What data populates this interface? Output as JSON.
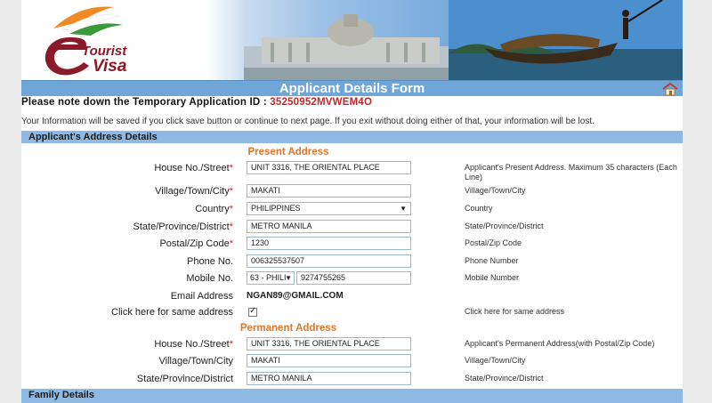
{
  "banner": {
    "logo_line1": "Tourist",
    "logo_line2": "Visa"
  },
  "header": {
    "title": "Applicant Details Form",
    "home_icon": "home-icon"
  },
  "notice": {
    "prefix": "Please note down the Temporary Application ID : ",
    "application_id": "35250952MVWEM4O",
    "info": "Your Information will be saved if you click save button or continue to next page. If you exit without doing either of that, your information will be lost."
  },
  "address_section": {
    "title": "Applicant's Address Details",
    "present_title": "Present Address",
    "permanent_title": "Permanent Address"
  },
  "present": {
    "house": {
      "label": "House No./Street",
      "required": "*",
      "value": "UNIT 3316, THE ORIENTAL PLACE",
      "hint": "Applicant's Present Address. Maximum 35 characters (Each Line)"
    },
    "village": {
      "label": "Village/Town/City",
      "required": "*",
      "value": "MAKATI",
      "hint": "Village/Town/City"
    },
    "country": {
      "label": "Country",
      "required": "*",
      "value": "PHILIPPINES",
      "hint": "Country"
    },
    "state": {
      "label": "State/Province/District",
      "required": "*",
      "value": "METRO MANILA",
      "hint": "State/Province/District"
    },
    "postal": {
      "label": "Postal/Zip Code",
      "required": "*",
      "value": "1230",
      "hint": "Postal/Zip Code"
    },
    "phone": {
      "label": "Phone No.",
      "value": "006325537507",
      "hint": "Phone Number"
    },
    "mobile": {
      "label": "Mobile No.",
      "code": "63 - PHILI",
      "value": "9274755265",
      "hint": "Mobile Number"
    },
    "email": {
      "label": "Email Address",
      "value": "NGAN89@GMAIL.COM"
    },
    "same": {
      "label": "Click here for same address",
      "hint": "Click here for same address"
    }
  },
  "permanent": {
    "house": {
      "label": "House No./Street",
      "required": "*",
      "value": "UNIT 3316, THE ORIENTAL PLACE",
      "hint": "Applicant's Permanent Address(with Postal/Zip Code)"
    },
    "village": {
      "label": "Village/Town/City",
      "value": "MAKATI",
      "hint": "Village/Town/City"
    },
    "state": {
      "label": "State/Province/District",
      "value": "METRO MANILA",
      "hint": "State/Province/District"
    }
  },
  "family_section": {
    "title": "Family Details"
  },
  "colors": {
    "title_bar": "#6fa6d7",
    "section_bar": "#8db9e3",
    "sub_title": "#e0762a",
    "app_id": "#c0282b",
    "required": "#d0202a"
  }
}
